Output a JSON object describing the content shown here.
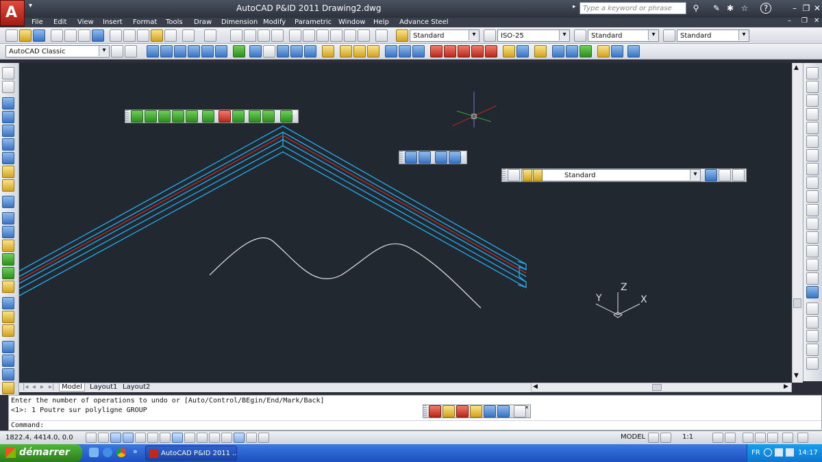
{
  "titlebar": {
    "app_button_label": "A",
    "title": "AutoCAD P&ID 2011    Drawing2.dwg",
    "search_placeholder": "Type a keyword or phrase",
    "help_glyph": "?",
    "icons": [
      "infocenter-icon",
      "communication-icon",
      "favorites-icon",
      "help-icon",
      "minimize-icon",
      "restore-icon",
      "close-icon"
    ]
  },
  "menubar": {
    "items": [
      "File",
      "Edit",
      "View",
      "Insert",
      "Format",
      "Tools",
      "Draw",
      "Dimension",
      "Modify",
      "Parametric",
      "Window",
      "Help",
      "Advance Steel"
    ]
  },
  "styles_toolbar": {
    "text_style": "Standard",
    "dim_style": "ISO-25",
    "table_style": "Standard",
    "multileader_style": "Standard"
  },
  "workspace": {
    "value": "AutoCAD Classic"
  },
  "floating_layer_toolbar": {
    "layer_value": "Standard"
  },
  "layout_tabs": {
    "items": [
      "Model",
      "Layout1",
      "Layout2"
    ],
    "active": "Model"
  },
  "command": {
    "history": [
      "Enter the number of operations to undo or [Auto/Control/BEgin/End/Mark/Back]",
      "<1>: 1 Poutre sur polyligne GROUP"
    ],
    "prompt": "Command:"
  },
  "status": {
    "coordinates": "1822.4, 4414.0, 0.0",
    "model_label": "MODEL",
    "annotation_scale": "1:1"
  },
  "ucs_labels": {
    "x": "X",
    "y": "Y",
    "z": "Z"
  },
  "taskbar": {
    "start_label": "démarrer",
    "task_item": "AutoCAD P&ID 2011 ...",
    "language": "FR",
    "clock": "14:17"
  },
  "colors": {
    "canvas": "#212830",
    "beam": "#26aef0",
    "axis_line": "#c0291e",
    "curve": "#e6e6e6"
  }
}
